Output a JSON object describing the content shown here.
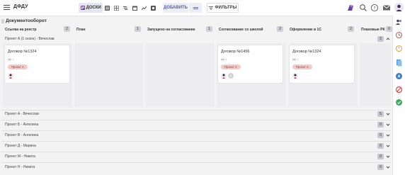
{
  "app": {
    "title": "ДФДУ"
  },
  "toolbar": {
    "view_active_label": "ДОСКИ",
    "add_label": "ДОБАВИТЬ",
    "filters_label": "ФИЛЬТРЫ"
  },
  "board": {
    "title": "Документооборот"
  },
  "columns": [
    {
      "label": "Ссылка на реестр",
      "count": "2"
    },
    {
      "label": "План",
      "count": "1"
    },
    {
      "label": "Запущено на согласование",
      "count": "1"
    },
    {
      "label": "Согласование со школой",
      "count": "2"
    },
    {
      "label": "Оформление в 1С",
      "count": "2"
    },
    {
      "label": "Плановые РК",
      "count": "0"
    }
  ],
  "expanded_lane": {
    "name": "Проект А (1 сезон) - Вячеслав",
    "count": "3",
    "cards": [
      {
        "title": "Договор №1324",
        "meta": "1",
        "tag": "Проект А",
        "avatar2": ""
      },
      {
        "title": "Договор №1456",
        "meta": "1",
        "tag": "Проект А",
        "avatar2": "А"
      },
      {
        "title": "Договор №1324",
        "meta": "1",
        "tag": "Проект А",
        "avatar2": ""
      }
    ]
  },
  "lanes": [
    {
      "name": "Проект А - Вячеслав",
      "count": "5"
    },
    {
      "name": "Проект Б - Ангелина",
      "count": "0"
    },
    {
      "name": "Проект В - Ангелина",
      "count": "0"
    },
    {
      "name": "Проект Д - Марина",
      "count": "0"
    },
    {
      "name": "Проект М - Никита",
      "count": "0"
    },
    {
      "name": "Проект Н - Никита",
      "count": "0"
    }
  ],
  "colors": {
    "accent": "#5c5f9f",
    "tag_bg": "#f6c9c9",
    "brand_purple": "#6b3fa0"
  }
}
